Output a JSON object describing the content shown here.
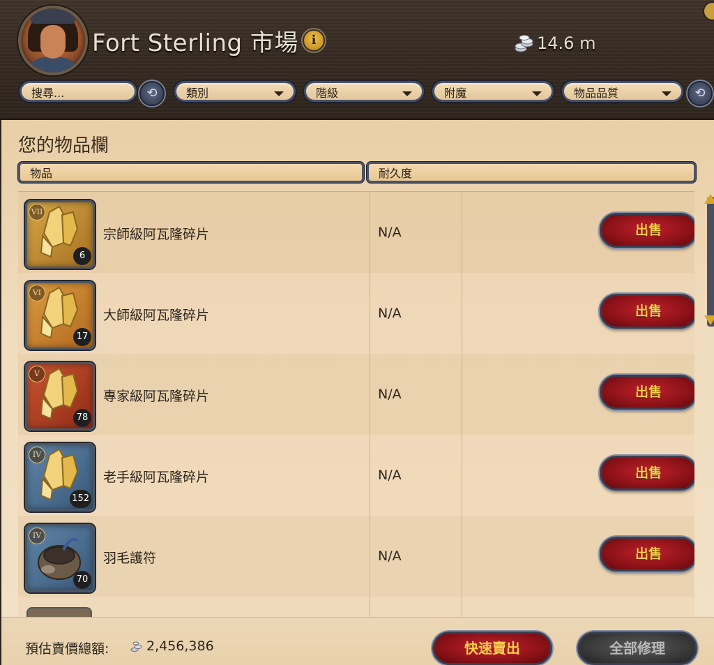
{
  "header": {
    "title": "Fort Sterling 市場",
    "info_icon": "i",
    "silver_amount": "14.6 m"
  },
  "filters": {
    "search_placeholder": "搜尋...",
    "category": "類別",
    "tier": "階級",
    "enchantment": "附魔",
    "quality": "物品品質"
  },
  "inventory": {
    "title": "您的物品欄",
    "columns": [
      "物品",
      "耐久度"
    ],
    "items": [
      {
        "name": "宗師級阿瓦隆碎片",
        "tier": "VII",
        "qty": "6",
        "durability": "N/A",
        "action": "出售",
        "tier_color": "t7"
      },
      {
        "name": "大師級阿瓦隆碎片",
        "tier": "VI",
        "qty": "17",
        "durability": "N/A",
        "action": "出售",
        "tier_color": "t6"
      },
      {
        "name": "專家級阿瓦隆碎片",
        "tier": "V",
        "qty": "78",
        "durability": "N/A",
        "action": "出售",
        "tier_color": "t5"
      },
      {
        "name": "老手級阿瓦隆碎片",
        "tier": "IV",
        "qty": "152",
        "durability": "N/A",
        "action": "出售",
        "tier_color": "t4"
      },
      {
        "name": "羽毛護符",
        "tier": "IV",
        "qty": "70",
        "durability": "N/A",
        "action": "出售",
        "tier_color": "t4"
      }
    ]
  },
  "footer": {
    "total_label": "預估賣價總額:",
    "total_value": "2,456,386",
    "quick_sell": "快速賣出",
    "repair_all": "全部修理"
  },
  "colors": {
    "sell_button": "#8d1218",
    "sell_text": "#f5d04a",
    "parchment": "#f0dcbe",
    "wood": "#372c23"
  },
  "icons": [
    "avatar",
    "info-icon",
    "silver-coins-icon",
    "reset-icon",
    "dropdown-caret-icon",
    "avalon-shard-icon",
    "feather-charm-icon",
    "scroll-up-icon",
    "scroll-down-icon"
  ]
}
